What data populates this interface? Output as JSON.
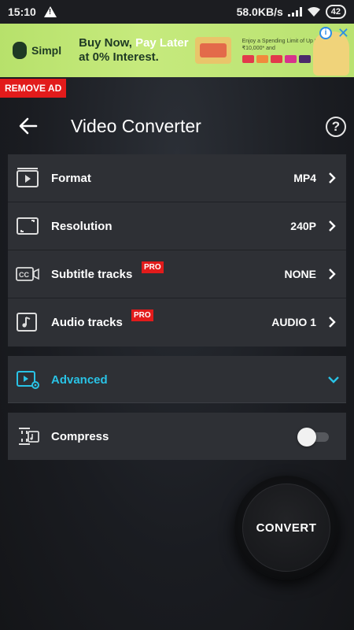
{
  "status": {
    "time": "15:10",
    "speed": "58.0KB/s",
    "battery": "42"
  },
  "ad": {
    "brand": "Simpl",
    "line1a": "Buy Now, ",
    "line1b": "Pay Later",
    "line2": "at 0% Interest.",
    "small": "Enjoy a Spending Limit of Up to ₹10,000* and",
    "remove_label": "REMOVE AD"
  },
  "header": {
    "title": "Video Converter"
  },
  "settings": [
    {
      "label": "Format",
      "value": "MP4",
      "pro": ""
    },
    {
      "label": "Resolution",
      "value": "240P",
      "pro": ""
    },
    {
      "label": "Subtitle tracks",
      "value": "NONE",
      "pro": "PRO"
    },
    {
      "label": "Audio tracks",
      "value": "AUDIO 1",
      "pro": "PRO"
    }
  ],
  "advanced": {
    "label": "Advanced"
  },
  "compress": {
    "label": "Compress",
    "enabled": false
  },
  "convert": {
    "label": "CONVERT"
  },
  "colors": {
    "accent": "#29c3e6",
    "pro_badge": "#e21b1b",
    "card": "#2e3035"
  },
  "icons": {
    "format": "play-frame-icon",
    "resolution": "resolution-frame-icon",
    "subtitle": "cc-icon",
    "audio": "music-note-icon",
    "advanced": "video-settings-icon",
    "compress": "compress-icon"
  }
}
